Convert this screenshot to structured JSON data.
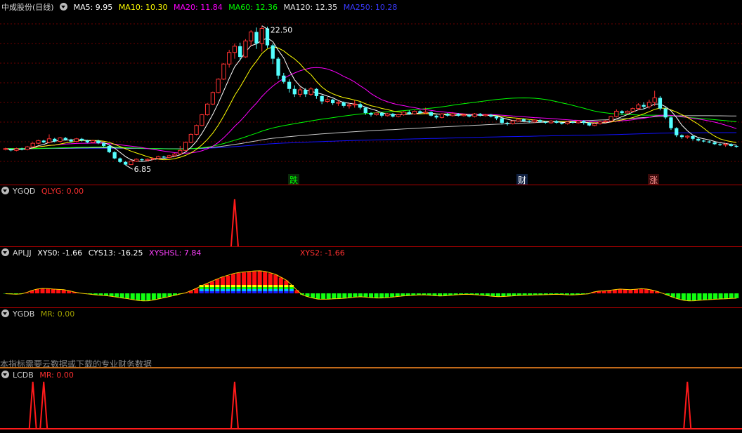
{
  "colors": {
    "bg": "#000000",
    "up": "#ff3232",
    "down": "#54ffff",
    "ma5": "#ffffff",
    "ma10": "#ffff00",
    "ma20": "#ff00ff",
    "ma60": "#00ff00",
    "ma120": "#c8c8c8",
    "ma250": "#1010ff",
    "grid": "#6e0000"
  },
  "main": {
    "title": "中成股份(日线)",
    "ma_labels": [
      {
        "text": "MA5: 9.95",
        "color": "#ffffff"
      },
      {
        "text": "MA10: 10.30",
        "color": "#ffff00"
      },
      {
        "text": "MA20: 11.84",
        "color": "#ff00ff"
      },
      {
        "text": "MA60: 12.36",
        "color": "#00ff00"
      },
      {
        "text": "MA120: 12.35",
        "color": "#e6e6e6"
      },
      {
        "text": "MA250: 10.28",
        "color": "#3a3aff"
      }
    ],
    "high_label": "22.50",
    "low_label": "6.85",
    "markers": [
      {
        "text": "跌",
        "color": "#00ff00",
        "bg": "#0a2a0a"
      },
      {
        "text": "财",
        "color": "#ffffff",
        "bg": "#102040"
      },
      {
        "text": "涨",
        "color": "#ff9090",
        "bg": "#3a0a0a"
      }
    ]
  },
  "ygqd": {
    "name": "YGQD",
    "label": "QLYG: 0.00"
  },
  "apljj": {
    "name": "APLJJ",
    "xys0": "XYS0: -1.66",
    "cys13": "CYS13: -16.25",
    "xyshsl": "XYSHSL: 7.84",
    "xys2": "XYS2: -1.66"
  },
  "ygdb": {
    "name": "YGDB",
    "label": "MR: 0.00",
    "note": "本指标需要云数据或下载的专业财务数据"
  },
  "lcdb": {
    "name": "LCDB",
    "label": "MR: 0.00"
  },
  "chart_data": [
    {
      "type": "candlestick",
      "title": "中成股份(日线)",
      "ylim": [
        6.0,
        23.5
      ],
      "annotations": {
        "max": 22.5,
        "min": 6.85
      },
      "candles": [
        [
          8.6,
          8.7,
          8.5,
          8.8
        ],
        [
          8.6,
          8.5,
          8.4,
          8.7
        ],
        [
          8.5,
          8.7,
          8.4,
          8.8
        ],
        [
          8.7,
          8.6,
          8.5,
          8.8
        ],
        [
          8.6,
          8.9,
          8.5,
          9.0
        ],
        [
          8.9,
          9.3,
          8.8,
          9.4
        ],
        [
          9.3,
          9.6,
          9.2,
          9.7
        ],
        [
          9.6,
          9.4,
          9.3,
          9.7
        ],
        [
          9.4,
          9.8,
          9.3,
          10.3
        ],
        [
          9.8,
          9.5,
          9.4,
          9.9
        ],
        [
          9.5,
          9.9,
          9.4,
          10.0
        ],
        [
          9.9,
          9.7,
          9.6,
          10.0
        ],
        [
          9.7,
          9.5,
          9.4,
          9.8
        ],
        [
          9.5,
          9.8,
          9.4,
          9.9
        ],
        [
          9.8,
          9.6,
          9.5,
          9.9
        ],
        [
          9.6,
          9.4,
          9.3,
          9.7
        ],
        [
          9.4,
          9.6,
          9.3,
          9.7
        ],
        [
          9.6,
          9.3,
          9.2,
          9.7
        ],
        [
          9.3,
          9.0,
          8.9,
          9.4
        ],
        [
          9.0,
          8.3,
          8.2,
          9.1
        ],
        [
          8.3,
          7.6,
          7.5,
          8.4
        ],
        [
          7.6,
          7.2,
          7.1,
          7.7
        ],
        [
          7.2,
          6.9,
          6.85,
          7.3
        ],
        [
          6.9,
          7.3,
          6.85,
          7.4
        ],
        [
          7.3,
          7.5,
          7.2,
          7.6
        ],
        [
          7.5,
          7.4,
          7.3,
          7.6
        ],
        [
          7.4,
          7.5,
          7.3,
          7.6
        ],
        [
          7.5,
          7.6,
          7.4,
          7.7
        ],
        [
          7.6,
          7.8,
          7.5,
          7.9
        ],
        [
          7.8,
          7.7,
          7.6,
          7.9
        ],
        [
          7.7,
          7.9,
          7.6,
          8.0
        ],
        [
          7.9,
          8.1,
          7.8,
          8.2
        ],
        [
          8.1,
          8.5,
          8.0,
          9.0
        ],
        [
          8.5,
          9.4,
          8.4,
          9.5
        ],
        [
          9.4,
          10.3,
          9.3,
          10.4
        ],
        [
          10.3,
          11.3,
          10.2,
          11.4
        ],
        [
          11.3,
          12.5,
          11.2,
          12.6
        ],
        [
          12.5,
          13.7,
          12.4,
          13.8
        ],
        [
          13.7,
          15.0,
          13.6,
          15.1
        ],
        [
          15.0,
          16.5,
          14.9,
          16.6
        ],
        [
          16.5,
          18.2,
          16.4,
          18.3
        ],
        [
          18.2,
          19.5,
          17.8,
          19.8
        ],
        [
          19.5,
          20.2,
          18.8,
          20.5
        ],
        [
          20.2,
          19.0,
          18.6,
          20.6
        ],
        [
          19.0,
          20.8,
          18.9,
          21.0
        ],
        [
          20.8,
          21.8,
          20.2,
          22.0
        ],
        [
          21.8,
          20.5,
          19.9,
          22.3
        ],
        [
          20.5,
          22.2,
          19.6,
          22.5
        ],
        [
          22.2,
          20.3,
          20.0,
          22.4
        ],
        [
          20.3,
          18.8,
          18.2,
          20.5
        ],
        [
          18.8,
          16.9,
          16.5,
          19.0
        ],
        [
          16.9,
          16.2,
          16.0,
          17.2
        ],
        [
          16.2,
          15.4,
          15.0,
          16.5
        ],
        [
          15.4,
          14.8,
          14.5,
          15.8
        ],
        [
          14.8,
          15.3,
          14.5,
          15.6
        ],
        [
          15.3,
          14.8,
          14.5,
          15.5
        ],
        [
          14.8,
          15.4,
          14.6,
          15.6
        ],
        [
          15.4,
          14.6,
          14.3,
          15.5
        ],
        [
          14.6,
          14.0,
          13.7,
          14.7
        ],
        [
          14.0,
          14.2,
          13.8,
          14.5
        ],
        [
          14.2,
          13.8,
          13.6,
          14.3
        ],
        [
          13.8,
          13.9,
          13.5,
          14.1
        ],
        [
          13.9,
          13.5,
          13.3,
          14.0
        ],
        [
          13.5,
          13.6,
          13.2,
          13.8
        ],
        [
          13.6,
          13.7,
          13.3,
          14.1
        ],
        [
          13.7,
          13.3,
          13.1,
          13.9
        ],
        [
          13.3,
          12.7,
          12.5,
          13.4
        ],
        [
          12.7,
          12.5,
          12.3,
          12.8
        ],
        [
          12.5,
          12.7,
          12.4,
          12.8
        ],
        [
          12.7,
          12.4,
          12.2,
          12.8
        ],
        [
          12.4,
          12.6,
          12.3,
          12.7
        ],
        [
          12.6,
          12.3,
          12.2,
          12.7
        ],
        [
          12.3,
          12.5,
          12.2,
          12.6
        ],
        [
          12.5,
          12.8,
          12.4,
          12.9
        ],
        [
          12.8,
          12.6,
          12.5,
          13.0
        ],
        [
          12.6,
          12.9,
          12.5,
          13.0
        ],
        [
          12.9,
          12.7,
          12.6,
          13.0
        ],
        [
          12.7,
          12.8,
          12.6,
          13.3
        ],
        [
          12.8,
          12.4,
          12.3,
          12.9
        ],
        [
          12.4,
          12.2,
          12.0,
          12.5
        ],
        [
          12.2,
          12.6,
          12.1,
          12.7
        ],
        [
          12.6,
          12.4,
          12.3,
          12.7
        ],
        [
          12.4,
          12.6,
          12.3,
          12.8
        ],
        [
          12.6,
          12.4,
          12.3,
          12.7
        ],
        [
          12.4,
          12.5,
          12.3,
          12.6
        ],
        [
          12.5,
          12.3,
          12.2,
          12.6
        ],
        [
          12.3,
          12.6,
          12.2,
          12.7
        ],
        [
          12.6,
          12.4,
          12.3,
          12.7
        ],
        [
          12.4,
          12.5,
          12.3,
          12.6
        ],
        [
          12.5,
          12.3,
          12.2,
          12.6
        ],
        [
          12.3,
          12.1,
          11.9,
          12.4
        ],
        [
          12.1,
          11.6,
          11.4,
          12.2
        ],
        [
          11.6,
          11.5,
          11.3,
          11.7
        ],
        [
          11.5,
          11.8,
          11.4,
          11.9
        ],
        [
          11.8,
          12.0,
          11.7,
          12.1
        ],
        [
          12.0,
          11.8,
          11.7,
          12.1
        ],
        [
          11.8,
          11.7,
          11.6,
          11.9
        ],
        [
          11.7,
          11.9,
          11.6,
          12.0
        ],
        [
          11.9,
          11.7,
          11.6,
          12.0
        ],
        [
          11.7,
          11.6,
          11.5,
          11.8
        ],
        [
          11.6,
          11.8,
          11.5,
          11.9
        ],
        [
          11.8,
          11.6,
          11.5,
          11.9
        ],
        [
          11.6,
          11.5,
          11.4,
          11.7
        ],
        [
          11.5,
          11.7,
          11.4,
          11.8
        ],
        [
          11.7,
          11.6,
          11.5,
          11.8
        ],
        [
          11.6,
          11.8,
          11.5,
          11.9
        ],
        [
          11.8,
          11.6,
          11.4,
          11.9
        ],
        [
          11.6,
          11.3,
          11.2,
          11.7
        ],
        [
          11.3,
          11.5,
          11.2,
          11.6
        ],
        [
          11.5,
          11.7,
          11.4,
          11.8
        ],
        [
          11.7,
          11.8,
          11.6,
          11.9
        ],
        [
          11.8,
          12.3,
          11.7,
          12.4
        ],
        [
          12.3,
          12.9,
          12.2,
          13.1
        ],
        [
          12.9,
          12.7,
          12.5,
          13.0
        ],
        [
          12.7,
          12.9,
          12.6,
          13.0
        ],
        [
          12.9,
          13.2,
          12.8,
          13.3
        ],
        [
          13.2,
          13.6,
          13.0,
          13.8
        ],
        [
          13.6,
          13.4,
          13.1,
          13.9
        ],
        [
          13.4,
          13.9,
          13.2,
          14.2
        ],
        [
          13.9,
          14.4,
          13.5,
          15.2
        ],
        [
          14.4,
          13.2,
          13.0,
          14.6
        ],
        [
          13.2,
          12.2,
          12.0,
          13.4
        ],
        [
          12.2,
          11.0,
          10.8,
          12.3
        ],
        [
          11.0,
          10.2,
          10.0,
          11.1
        ],
        [
          10.2,
          10.0,
          9.8,
          10.3
        ],
        [
          10.0,
          10.1,
          9.8,
          10.2
        ],
        [
          10.1,
          9.8,
          9.6,
          10.2
        ],
        [
          9.8,
          9.6,
          9.5,
          9.9
        ],
        [
          9.6,
          9.5,
          9.4,
          9.7
        ],
        [
          9.5,
          9.4,
          9.3,
          9.6
        ],
        [
          9.4,
          9.2,
          9.1,
          9.5
        ],
        [
          9.2,
          9.1,
          9.0,
          9.3
        ],
        [
          9.1,
          9.2,
          8.9,
          9.3
        ],
        [
          9.2,
          9.0,
          8.9,
          9.3
        ],
        [
          9.0,
          8.9,
          8.8,
          9.1
        ]
      ],
      "ma": {
        "MA5": {
          "last": 9.95,
          "color": "#ffffff"
        },
        "MA10": {
          "last": 10.3,
          "color": "#ffff00"
        },
        "MA20": {
          "last": 11.84,
          "color": "#ff00ff"
        },
        "MA60": {
          "last": 12.36,
          "color": "#00ff00"
        },
        "MA120": {
          "last": 12.35,
          "color": "#c8c8c8"
        },
        "MA250": {
          "last": 10.28,
          "color": "#1010ff"
        }
      }
    },
    {
      "type": "line",
      "name": "YGQD",
      "series": [
        {
          "name": "QLYG",
          "spikes": [
            {
              "index": 42,
              "value": 1
            }
          ]
        }
      ],
      "ylim": [
        0,
        1
      ]
    },
    {
      "type": "bar",
      "name": "APLJJ",
      "values": [
        -0.2,
        -0.4,
        -0.5,
        -0.3,
        0.5,
        1.8,
        2.6,
        3.0,
        2.9,
        2.6,
        2.4,
        2.2,
        1.6,
        0.8,
        0.2,
        -0.2,
        -0.5,
        -0.9,
        -1.2,
        -1.4,
        -1.8,
        -2.3,
        -2.8,
        -3.2,
        -3.8,
        -4.3,
        -4.6,
        -4.5,
        -4.0,
        -3.3,
        -2.6,
        -1.9,
        -1.2,
        -0.4,
        0.3,
        1.6,
        3.0,
        4.6,
        6.0,
        7.4,
        8.8,
        10.1,
        11.0,
        12.0,
        12.6,
        13.0,
        13.3,
        13.6,
        13.7,
        13.3,
        12.5,
        11.5,
        9.8,
        8.0,
        5.2,
        2.0,
        -0.8,
        -2.0,
        -2.8,
        -3.5,
        -3.6,
        -3.5,
        -3.3,
        -3.2,
        -3.0,
        -2.7,
        -2.3,
        -2.1,
        -2.3,
        -2.6,
        -2.8,
        -2.8,
        -2.6,
        -2.3,
        -1.9,
        -1.6,
        -1.4,
        -1.2,
        -1.0,
        -0.9,
        -1.1,
        -1.4,
        -1.6,
        -1.5,
        -1.2,
        -0.9,
        -0.7,
        -0.6,
        -0.7,
        -0.9,
        -1.2,
        -1.5,
        -1.8,
        -2.0,
        -1.9,
        -1.7,
        -1.5,
        -1.3,
        -1.2,
        -1.1,
        -1.0,
        -0.9,
        -0.8,
        -0.7,
        -0.6,
        -0.7,
        -0.9,
        -1.0,
        -0.8,
        -0.5,
        -0.3,
        0.8,
        1.4,
        1.5,
        1.8,
        2.2,
        2.6,
        2.4,
        2.2,
        2.5,
        2.8,
        2.6,
        2.0,
        1.2,
        0.1,
        -1.1,
        -2.4,
        -3.4,
        -4.2,
        -4.6,
        -4.5,
        -4.2,
        -4.0,
        -3.8,
        -3.6,
        -3.4,
        -3.3,
        -3.1,
        -3.0
      ],
      "xys0": -1.66,
      "cys13": -16.25,
      "xyshsl": 7.84,
      "xys2": -1.66
    },
    {
      "type": "line",
      "name": "LCDB",
      "series": [
        {
          "name": "MR",
          "spikes": [
            {
              "index": 5,
              "value": 1
            },
            {
              "index": 7,
              "value": 1
            },
            {
              "index": 42,
              "value": 1
            },
            {
              "index": 125,
              "value": 1
            }
          ]
        }
      ],
      "ylim": [
        0,
        1
      ]
    }
  ]
}
